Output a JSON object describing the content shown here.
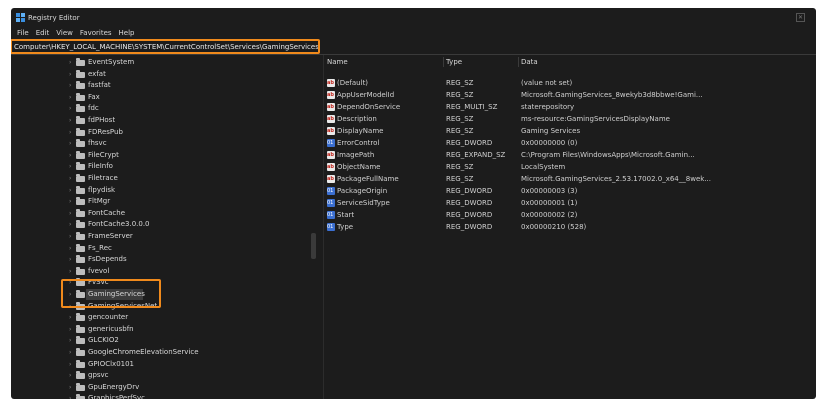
{
  "window": {
    "title": "Registry Editor"
  },
  "menu": [
    "File",
    "Edit",
    "View",
    "Favorites",
    "Help"
  ],
  "address": "Computer\\HKEY_LOCAL_MACHINE\\SYSTEM\\CurrentControlSet\\Services\\GamingServices",
  "colors": {
    "highlight": "#f08a1c",
    "background": "#1c1c1c"
  },
  "tree": {
    "items": [
      "EventSystem",
      "exfat",
      "fastfat",
      "Fax",
      "fdc",
      "fdPHost",
      "FDResPub",
      "fhsvc",
      "FileCrypt",
      "FileInfo",
      "Filetrace",
      "flpydisk",
      "FltMgr",
      "FontCache",
      "FontCache3.0.0.0",
      "FrameServer",
      "Fs_Rec",
      "FsDepends",
      "fvevol",
      "FvSvc",
      "GamingServices",
      "GamingServicesNet",
      "gencounter",
      "genericusbfn",
      "GLCKIO2",
      "GoogleChromeElevationService",
      "GPIOClx0101",
      "gpsvc",
      "GpuEnergyDrv",
      "GraphicsPerfSvc"
    ],
    "selected": "GamingServices"
  },
  "values": {
    "headers": {
      "name": "Name",
      "type": "Type",
      "data": "Data"
    },
    "rows": [
      {
        "icon": "string-value-icon",
        "name": "(Default)",
        "type": "REG_SZ",
        "data": "(value not set)"
      },
      {
        "icon": "string-value-icon",
        "name": "AppUserModelId",
        "type": "REG_SZ",
        "data": "Microsoft.GamingServices_8wekyb3d8bbwe!Gami..."
      },
      {
        "icon": "string-value-icon",
        "name": "DependOnService",
        "type": "REG_MULTI_SZ",
        "data": "staterepository"
      },
      {
        "icon": "string-value-icon",
        "name": "Description",
        "type": "REG_SZ",
        "data": "ms-resource:GamingServicesDisplayName"
      },
      {
        "icon": "string-value-icon",
        "name": "DisplayName",
        "type": "REG_SZ",
        "data": "Gaming Services"
      },
      {
        "icon": "dword-value-icon",
        "name": "ErrorControl",
        "type": "REG_DWORD",
        "data": "0x00000000 (0)"
      },
      {
        "icon": "string-value-icon",
        "name": "ImagePath",
        "type": "REG_EXPAND_SZ",
        "data": "C:\\Program Files\\WindowsApps\\Microsoft.Gamin..."
      },
      {
        "icon": "string-value-icon",
        "name": "ObjectName",
        "type": "REG_SZ",
        "data": "LocalSystem"
      },
      {
        "icon": "string-value-icon",
        "name": "PackageFullName",
        "type": "REG_SZ",
        "data": "Microsoft.GamingServices_2.53.17002.0_x64__8wek..."
      },
      {
        "icon": "dword-value-icon",
        "name": "PackageOrigin",
        "type": "REG_DWORD",
        "data": "0x00000003 (3)"
      },
      {
        "icon": "dword-value-icon",
        "name": "ServiceSidType",
        "type": "REG_DWORD",
        "data": "0x00000001 (1)"
      },
      {
        "icon": "dword-value-icon",
        "name": "Start",
        "type": "REG_DWORD",
        "data": "0x00000002 (2)"
      },
      {
        "icon": "dword-value-icon",
        "name": "Type",
        "type": "REG_DWORD",
        "data": "0x00000210 (528)"
      }
    ]
  }
}
